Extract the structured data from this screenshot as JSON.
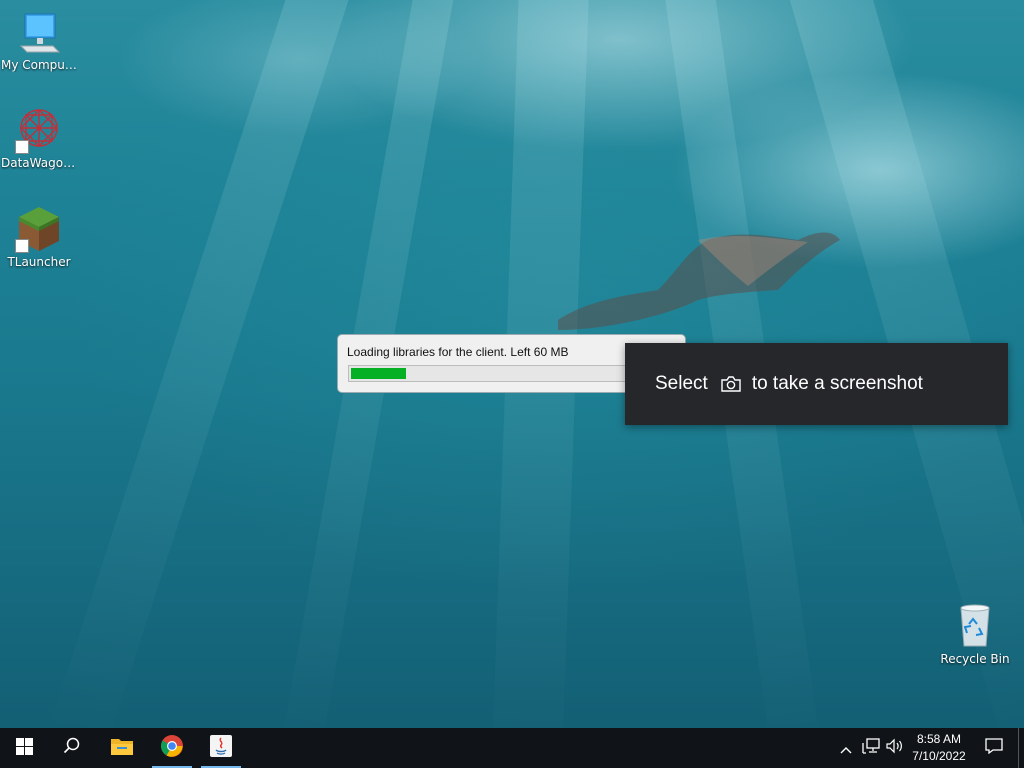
{
  "desktop": {
    "icons": [
      {
        "label": "My Computer",
        "icon": "computer-icon"
      },
      {
        "label": "DataWagon...",
        "icon": "datawagon-icon"
      },
      {
        "label": "TLauncher",
        "icon": "tlauncher-icon"
      },
      {
        "label": "Recycle Bin",
        "icon": "recycle-bin-icon"
      }
    ]
  },
  "loader": {
    "message": "Loading libraries for the client. Left 60 MB",
    "progress_fraction": 0.17,
    "bar_color": "#06b025"
  },
  "toast": {
    "before": "Select",
    "after": "to take a screenshot",
    "icon": "camera-icon"
  },
  "taskbar": {
    "buttons": [
      {
        "icon": "windows-start-icon"
      },
      {
        "icon": "search-icon"
      },
      {
        "icon": "file-explorer-icon"
      },
      {
        "icon": "chrome-icon",
        "active": true
      },
      {
        "icon": "java-icon",
        "active": true
      }
    ],
    "tray": {
      "icons": [
        "chevron-up-icon",
        "network-icon",
        "volume-icon"
      ],
      "time": "8:58 AM",
      "date": "7/10/2022"
    }
  },
  "colors": {
    "taskbar": "#101418",
    "toast_bg": "#25272a",
    "active_indicator": "#76b9ed"
  }
}
